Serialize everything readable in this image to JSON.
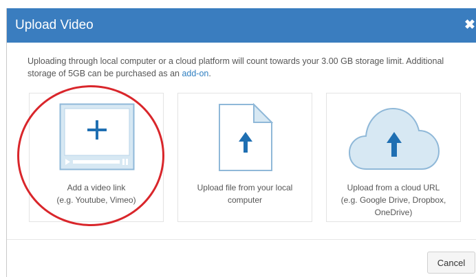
{
  "dialog": {
    "title": "Upload Video",
    "close_glyph": "✖",
    "description_text": "Uploading through local computer or a cloud platform will count towards your 3.00 GB storage limit. Additional storage of 5GB can be purchased as an ",
    "description_link": "add-on",
    "description_end": "."
  },
  "options": [
    {
      "icon": "video-plus-icon",
      "line1": "Add a video link",
      "line2": "(e.g. Youtube, Vimeo)"
    },
    {
      "icon": "file-upload-icon",
      "line1": "Upload file from your local",
      "line2": "computer"
    },
    {
      "icon": "cloud-upload-icon",
      "line1": "Upload from a cloud URL",
      "line2": "(e.g. Google Drive, Dropbox,",
      "line3": "OneDrive)"
    }
  ],
  "footer": {
    "cancel_label": "Cancel"
  },
  "colors": {
    "header": "#3a7dbf",
    "icon_fill": "#d7e8f3",
    "icon_stroke": "#8fb8d8",
    "arrow": "#1f6fb2",
    "annotation_circle": "#d9262b"
  }
}
